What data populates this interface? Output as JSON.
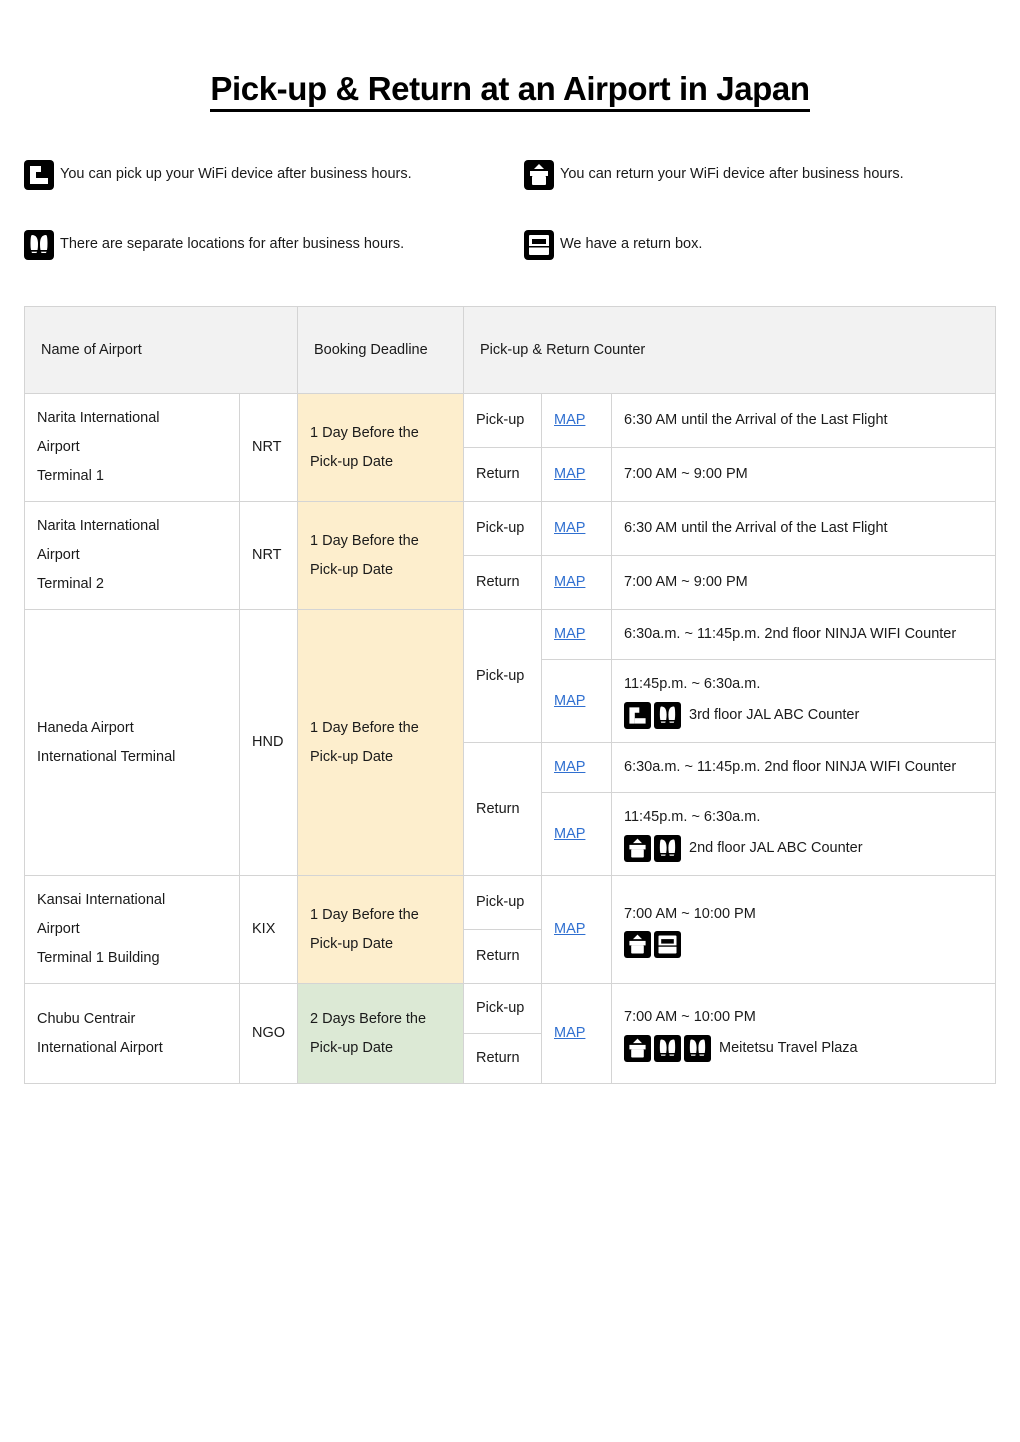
{
  "title": "Pick-up & Return at an Airport in Japan",
  "legend": [
    {
      "icon": "pickup-after-hours-icon",
      "text": "You can pick up your WiFi device after business hours."
    },
    {
      "icon": "return-after-hours-icon",
      "text": "You can return your WiFi device after business hours."
    },
    {
      "icon": "separate-locations-icon",
      "text": "There are separate locations for after business hours."
    },
    {
      "icon": "return-box-icon",
      "text": "We have a return box."
    }
  ],
  "table": {
    "headers": {
      "name": "Name of Airport",
      "deadline": "Booking Deadline",
      "counter": "Pick-up & Return Counter"
    },
    "map_label": "MAP",
    "rows": [
      {
        "name_lines": [
          "Narita International",
          "Airport",
          "Terminal 1"
        ],
        "code": "NRT",
        "deadline": "1 Day Before the Pick-up Date",
        "deadline_highlight": "#fdeecd",
        "entries": [
          {
            "direction": "Pick-up",
            "map": "MAP",
            "info_lines": [
              "6:30 AM until the Arrival of the Last Flight"
            ]
          },
          {
            "direction": "Return",
            "map": "MAP",
            "info_lines": [
              "7:00 AM ~ 9:00 PM"
            ]
          }
        ]
      },
      {
        "name_lines": [
          "Narita International",
          "Airport",
          "Terminal 2"
        ],
        "code": "NRT",
        "deadline": "1 Day Before the Pick-up Date",
        "deadline_highlight": "#fdeecd",
        "entries": [
          {
            "direction": "Pick-up",
            "map": "MAP",
            "info_lines": [
              "6:30 AM until the Arrival of the Last Flight"
            ]
          },
          {
            "direction": "Return",
            "map": "MAP",
            "info_lines": [
              "7:00 AM ~ 9:00 PM"
            ]
          }
        ]
      },
      {
        "name_lines": [
          "Haneda Airport",
          "International Terminal"
        ],
        "code": "HND",
        "deadline": "1 Day Before the Pick-up Date",
        "deadline_highlight": "#fdeecd",
        "entries": [
          {
            "direction": "Pick-up",
            "sub": [
              {
                "map": "MAP",
                "info_lines": [
                  "6:30a.m. ~ 11:45p.m. 2nd floor NINJA WIFI Counter"
                ],
                "icons": [],
                "icon_label": ""
              },
              {
                "map": "MAP",
                "info_lines": [
                  "11:45p.m. ~ 6:30a.m."
                ],
                "icons": [
                  "pickup-after-hours-icon",
                  "separate-locations-icon"
                ],
                "icon_label": "3rd floor JAL ABC Counter"
              }
            ]
          },
          {
            "direction": "Return",
            "sub": [
              {
                "map": "MAP",
                "info_lines": [
                  "6:30a.m. ~ 11:45p.m. 2nd floor NINJA WIFI Counter"
                ],
                "icons": [],
                "icon_label": ""
              },
              {
                "map": "MAP",
                "info_lines": [
                  "11:45p.m. ~ 6:30a.m."
                ],
                "icons": [
                  "return-after-hours-icon",
                  "separate-locations-icon"
                ],
                "icon_label": "2nd floor JAL ABC Counter"
              }
            ]
          }
        ]
      },
      {
        "name_lines": [
          "Kansai International",
          "Airport",
          "Terminal 1 Building"
        ],
        "code": "KIX",
        "deadline": "1 Day Before the Pick-up Date",
        "deadline_highlight": "#fdeecd",
        "merged": {
          "map": "MAP",
          "info_lines": [
            "7:00 AM ~ 10:00 PM"
          ],
          "icons": [
            "return-after-hours-icon",
            "return-box-icon"
          ],
          "icon_label": ""
        },
        "entries": [
          {
            "direction": "Pick-up"
          },
          {
            "direction": "Return"
          }
        ]
      },
      {
        "name_lines": [
          "Chubu Centrair",
          "International Airport"
        ],
        "code": "NGO",
        "deadline": "2 Days Before the Pick-up Date",
        "deadline_highlight": "#dce9d5",
        "merged": {
          "map": "MAP",
          "info_lines": [
            "7:00 AM ~ 10:00 PM"
          ],
          "icons": [
            "return-after-hours-icon",
            "separate-locations-icon",
            "separate-locations-icon"
          ],
          "icon_label": "Meitetsu Travel Plaza"
        },
        "entries": [
          {
            "direction": "Pick-up"
          },
          {
            "direction": "Return"
          }
        ]
      }
    ]
  },
  "colors": {
    "yellow_highlight": "#fdeecd",
    "green_highlight": "#dce9d5",
    "header_bg": "#f2f2f2",
    "link": "#2f6fd0",
    "border": "#d4d4d4",
    "text": "#1a1a1a"
  }
}
